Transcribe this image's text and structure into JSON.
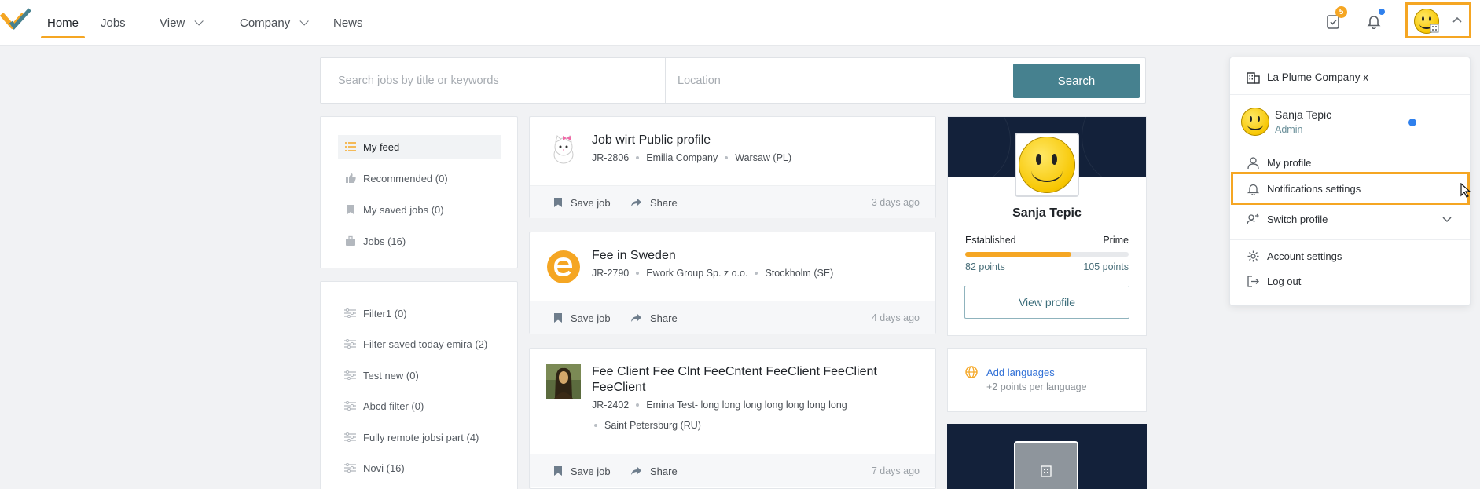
{
  "nav": {
    "home": "Home",
    "jobs": "Jobs",
    "view": "View",
    "company": "Company",
    "news": "News",
    "tasks_badge": "5"
  },
  "search": {
    "keywords_placeholder": "Search jobs by title or keywords",
    "location_placeholder": "Location",
    "button": "Search"
  },
  "feed_menu": [
    {
      "label": "My feed",
      "icon": "list-icon"
    },
    {
      "label": "Recommended (0)",
      "icon": "thumbs-up-icon"
    },
    {
      "label": "My saved jobs (0)",
      "icon": "bookmark-icon"
    },
    {
      "label": "Jobs (16)",
      "icon": "briefcase-icon"
    }
  ],
  "filters": [
    "Filter1 (0)",
    "Filter saved today emira (2)",
    "Test new (0)",
    "Abcd filter (0)",
    "Fully remote jobsi part (4)",
    "Novi (16)"
  ],
  "jobs": [
    {
      "title": "Job wirt Public profile",
      "id": "JR-2806",
      "company": "Emilia Company",
      "location": "Warsaw (PL)",
      "ago": "3 days ago"
    },
    {
      "title": "Fee in Sweden",
      "id": "JR-2790",
      "company": "Ework Group Sp. z o.o.",
      "location": "Stockholm (SE)",
      "ago": "4 days ago"
    },
    {
      "title_line1": "Fee Client Fee Clnt FeeCntent FeeClient FeeClient",
      "title_line2": "FeeClient",
      "id": "JR-2402",
      "company": "Emina Test- long long long long long long long",
      "location": "Saint Petersburg (RU)",
      "ago": "7 days ago"
    }
  ],
  "job_actions": {
    "save": "Save job",
    "share": "Share"
  },
  "profile": {
    "name": "Sanja Tepic",
    "level_left": "Established",
    "level_right": "Prime",
    "points_left": "82 points",
    "points_right": "105 points",
    "progress": 0.65,
    "view_button": "View profile"
  },
  "languages": {
    "link": "Add languages",
    "hint": "+2 points per language"
  },
  "dropdown": {
    "company": "La Plume Company x",
    "user_name": "Sanja Tepic",
    "user_role": "Admin",
    "my_profile": "My profile",
    "notifications": "Notifications settings",
    "switch_profile": "Switch profile",
    "account_settings": "Account settings",
    "log_out": "Log out"
  },
  "colors": {
    "accent": "#f5a623",
    "primary": "#46818f",
    "navy": "#13213a",
    "link": "#2f80ed"
  }
}
